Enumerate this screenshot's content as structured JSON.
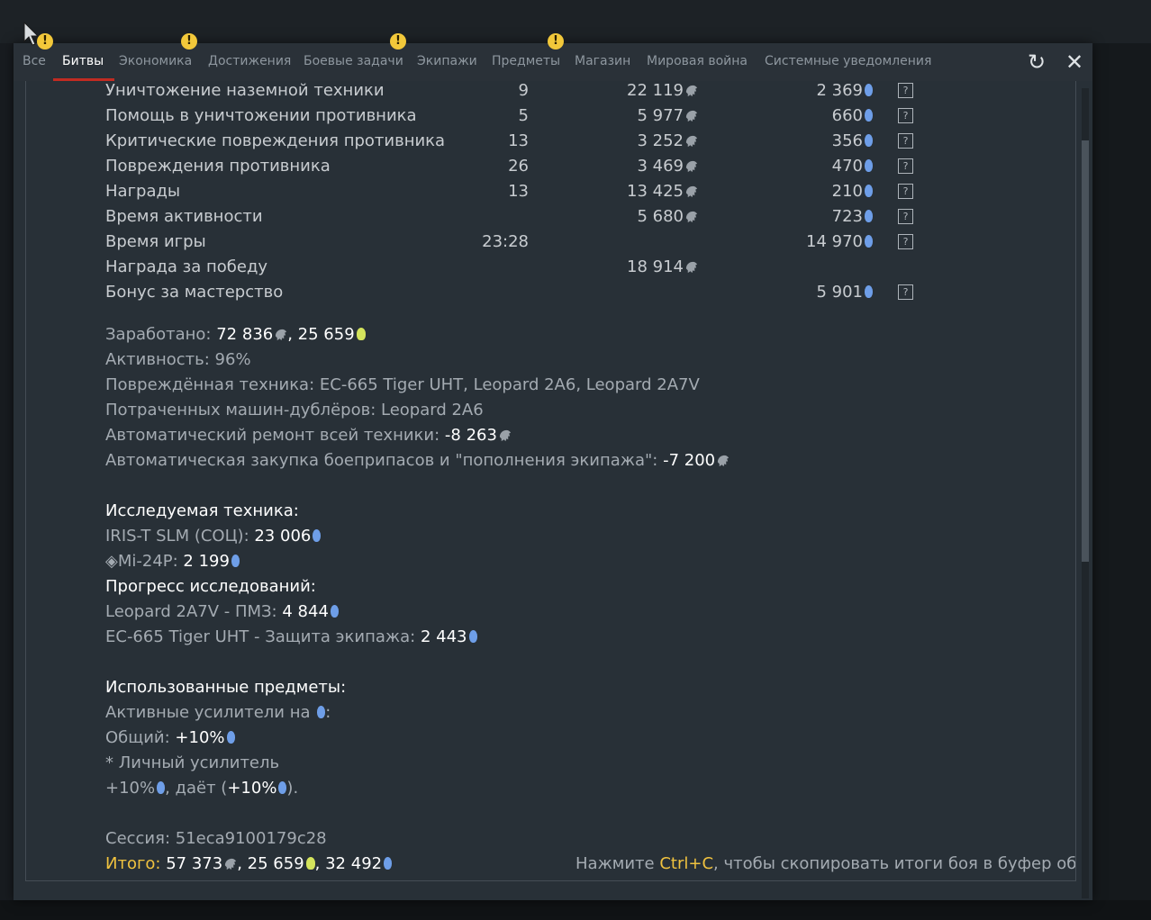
{
  "tabs": [
    {
      "label": "Все",
      "warn": true
    },
    {
      "label": "Битвы",
      "warn": false,
      "active": true
    },
    {
      "label": "Экономика",
      "warn": true
    },
    {
      "label": "Достижения",
      "warn": false
    },
    {
      "label": "Боевые задачи",
      "warn": true
    },
    {
      "label": "Экипажи",
      "warn": false
    },
    {
      "label": "Предметы",
      "warn": true
    },
    {
      "label": "Магазин",
      "warn": false
    },
    {
      "label": "Мировая война",
      "warn": false
    },
    {
      "label": "Системные уведомления",
      "warn": false
    }
  ],
  "warn_glyph": "!",
  "controls": {
    "refresh": "↻",
    "close": "✕"
  },
  "table": {
    "rows": [
      {
        "label": "Уничтожение наземной техники",
        "count": "9",
        "silver": "22 119",
        "rp": "2 369",
        "q": true
      },
      {
        "label": "Помощь в уничтожении противника",
        "count": "5",
        "silver": "5 977",
        "rp": "660",
        "q": true
      },
      {
        "label": "Критические повреждения противника",
        "count": "13",
        "silver": "3 252",
        "rp": "356",
        "q": true
      },
      {
        "label": "Повреждения противника",
        "count": "26",
        "silver": "3 469",
        "rp": "470",
        "q": true
      },
      {
        "label": "Награды",
        "count": "13",
        "silver": "13 425",
        "rp": "210",
        "q": true
      },
      {
        "label": "Время активности",
        "count": "",
        "silver": "5 680",
        "rp": "723",
        "q": true
      },
      {
        "label": "Время игры",
        "count": "23:28",
        "silver": "",
        "rp": "14 970",
        "q": true
      },
      {
        "label": "Награда за победу",
        "count": "",
        "silver": "18 914",
        "rp": "",
        "q": false
      },
      {
        "label": "Бонус за мастерство",
        "count": "",
        "silver": "",
        "rp": "5 901",
        "q": true
      }
    ],
    "q_glyph": "?"
  },
  "summary": {
    "earned_label": "Заработано: ",
    "earned_silver": "72 836",
    "earned_sep": ", ",
    "earned_conv": "25 659",
    "activity_label": "Активность: ",
    "activity_value": "96%",
    "damaged_label": "Повреждённая техника: ",
    "damaged_value": "EC-665 Tiger UHT, Leopard 2A6, Leopard 2A7V",
    "spare_label": "Потраченных машин-дублёров: ",
    "spare_value": "Leopard 2A6",
    "repair_label": "Автоматический ремонт всей техники: ",
    "repair_value": "-8 263",
    "ammo_label": "Автоматическая закупка боеприпасов и \"пополнения экипажа\": ",
    "ammo_value": "-7 200"
  },
  "research": {
    "header": "Исследуемая техника:",
    "v1_label": "IRIS-T SLM (СОЦ): ",
    "v1_value": "23 006",
    "v2_label": "◈Mi-24P: ",
    "v2_value": "2 199",
    "progress_header": "Прогресс исследований:",
    "p1_label": "Leopard 2A7V - ПМЗ: ",
    "p1_value": "4 844",
    "p2_label": "EC-665 Tiger UHT - Защита экипажа: ",
    "p2_value": "2 443"
  },
  "items": {
    "header": "Использованные предметы:",
    "boosters_label": "Активные усилители на ",
    "boosters_suffix": ":",
    "general_label": "Общий: ",
    "general_value": "+10%",
    "personal_label": "* Личный усилитель",
    "personal_value": "+10%",
    "gives_label": ", даёт (",
    "gives_value": "+10%",
    "gives_suffix": ")."
  },
  "session": {
    "label": "Сессия: ",
    "value": "51eca9100179c28"
  },
  "total": {
    "label": "Итого:",
    "silver": " 57 373",
    "conv": "25 659",
    "rp": "32 492",
    "sep": ", "
  },
  "hint": {
    "prefix": "Нажмите ",
    "key": "Ctrl+C",
    "suffix": ", чтобы скопировать итоги боя в буфер обмена"
  },
  "colors": {
    "accent": "#c12b22",
    "gold": "#f0c23f",
    "rp": "#6e9ee8",
    "bulb": "#d4e45c",
    "warn": "#f2c83a"
  }
}
